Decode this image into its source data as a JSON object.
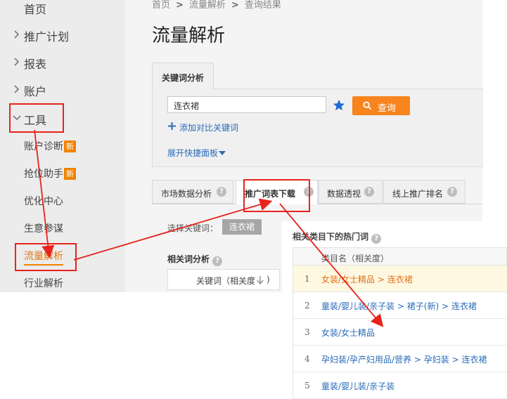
{
  "sidebar": {
    "items": [
      {
        "label": "首页"
      },
      {
        "label": "推广计划"
      },
      {
        "label": "报表"
      },
      {
        "label": "账户"
      },
      {
        "label": "工具"
      }
    ],
    "tools_sub": [
      {
        "label": "账户诊断",
        "badge": "新"
      },
      {
        "label": "抢位助手",
        "badge": "新"
      },
      {
        "label": "优化中心"
      },
      {
        "label": "生意参谋"
      },
      {
        "label": "流量解析"
      },
      {
        "label": "行业解析"
      }
    ]
  },
  "breadcrumb": [
    "首页",
    "流量解析",
    "查询结果"
  ],
  "page_title": "流量解析",
  "keyword_panel": {
    "tab_label": "关键词分析",
    "input_value": "连衣裙",
    "query_button": "查询",
    "add_compare_link": "添加对比关键词",
    "expand_link": "展开快捷面板"
  },
  "tabs": [
    {
      "label": "市场数据分析",
      "help": "?"
    },
    {
      "label": "推广词表下载",
      "help": "?",
      "active": true
    },
    {
      "label": "数据透视",
      "help": "?"
    },
    {
      "label": "线上推广排名",
      "help": "?"
    }
  ],
  "select_keyword": {
    "label": "选择关键词：",
    "chip": "连衣裙"
  },
  "related_analysis": {
    "heading": "相关词分析",
    "col_header": "关键词（相关度"
  },
  "popup": {
    "title": "相关类目下的热门词",
    "col_header": "类目名（相关度）",
    "rows": [
      {
        "num": "1",
        "category": "女装/女士精品 > 连衣裙"
      },
      {
        "num": "2",
        "category": "童装/婴儿装/亲子装 > 裙子(新) > 连衣裙"
      },
      {
        "num": "3",
        "category": "女装/女士精品"
      },
      {
        "num": "4",
        "category": "孕妇装/孕产妇用品/营养 > 孕妇装 > 连衣裙"
      },
      {
        "num": "5",
        "category": "童装/婴儿装/亲子装"
      }
    ]
  },
  "colors": {
    "accent": "#f7841c",
    "annotation": "#e8231d",
    "link": "#2a6bb8",
    "badge": "#f08300"
  }
}
